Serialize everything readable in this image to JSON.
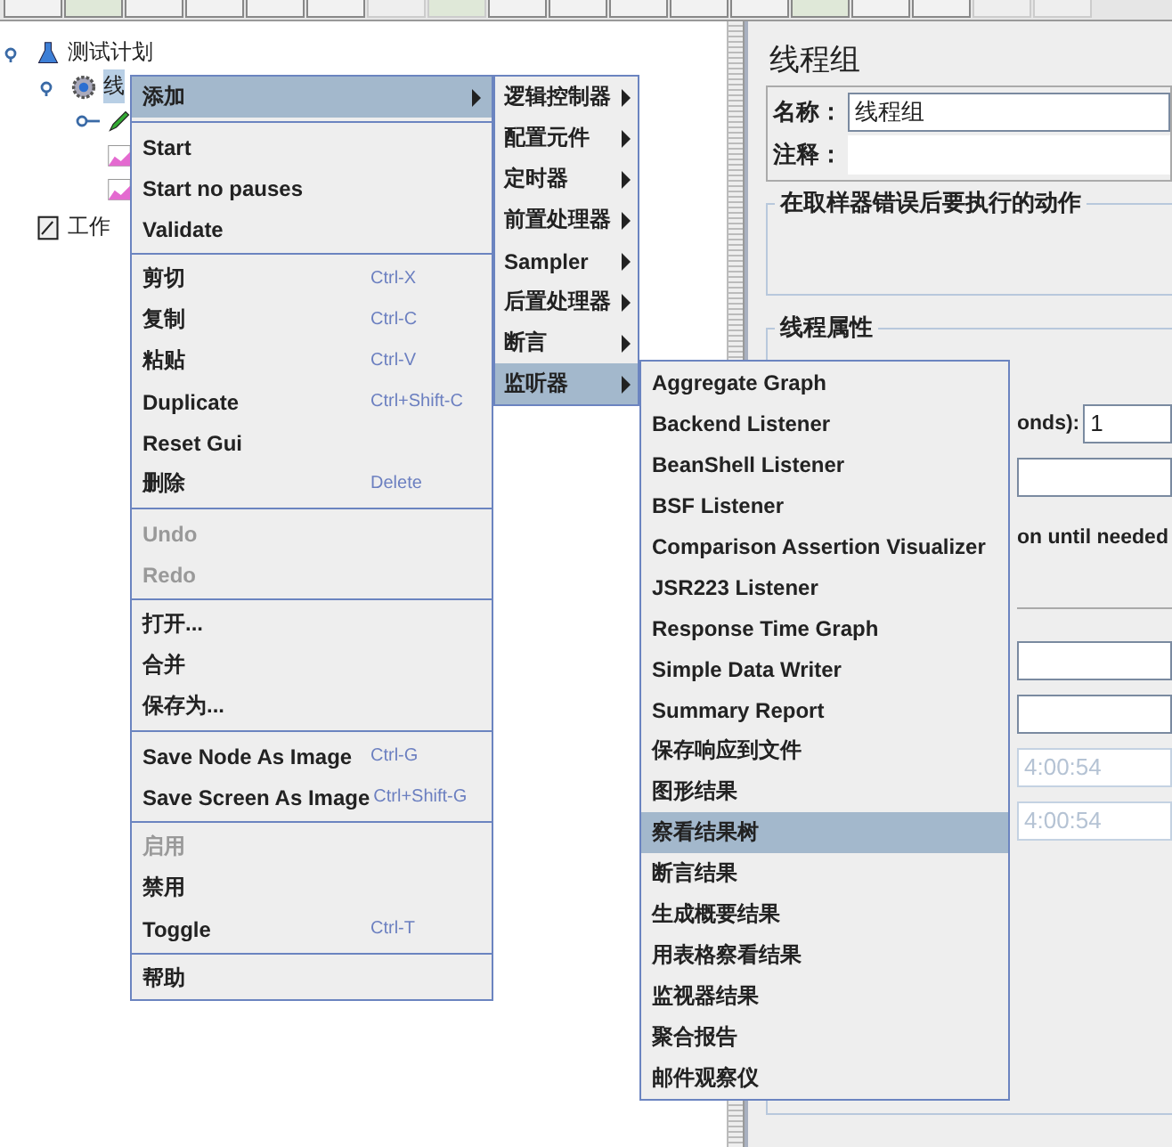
{
  "toolbar": {
    "buttons": [
      {
        "disabled": false
      },
      {
        "disabled": false
      },
      {
        "disabled": false
      },
      {
        "disabled": false
      },
      {
        "disabled": false
      },
      {
        "disabled": false
      },
      {
        "disabled": true
      },
      {
        "disabled": true
      },
      {
        "disabled": false
      },
      {
        "disabled": false
      },
      {
        "disabled": false
      },
      {
        "disabled": false
      },
      {
        "disabled": false
      },
      {
        "disabled": false
      },
      {
        "disabled": false
      },
      {
        "disabled": false
      },
      {
        "disabled": true
      },
      {
        "disabled": true
      }
    ]
  },
  "tree": [
    {
      "label": "测试计划",
      "kind": "plan",
      "selected": false,
      "expanded": true,
      "children": [
        {
          "label": "线",
          "kind": "thread-group",
          "selected": true,
          "expanded": true,
          "children": [
            {
              "kind": "sampler",
              "expanded": false
            },
            {
              "kind": "listener"
            },
            {
              "kind": "listener"
            }
          ]
        }
      ]
    },
    {
      "label": "工作",
      "kind": "workbench",
      "selected": false
    }
  ],
  "panel": {
    "title": "线程组",
    "name_label": "名称：",
    "name_value": "线程组",
    "comment_label": "注释：",
    "error_action_title": "在取样器错误后要执行的动作",
    "thread_props_title": "线程属性",
    "fragments": [
      {
        "kind": "label-input",
        "label": "onds):",
        "value": "1"
      },
      {
        "kind": "input"
      },
      {
        "kind": "text",
        "text": "on until needed"
      },
      {
        "kind": "rule"
      },
      {
        "kind": "input"
      },
      {
        "kind": "input"
      },
      {
        "kind": "disabled-input",
        "value": "4:00:54"
      },
      {
        "kind": "disabled-input",
        "value": "4:00:54"
      }
    ]
  },
  "context_menu": {
    "groups": [
      [
        {
          "label": "添加",
          "disabled": false,
          "selected": true,
          "submenu": true
        }
      ],
      [
        {
          "label": "Start",
          "disabled": false,
          "selected": false,
          "submenu": false
        },
        {
          "label": "Start no pauses",
          "disabled": false,
          "selected": false,
          "submenu": false
        },
        {
          "label": "Validate",
          "disabled": false,
          "selected": false,
          "submenu": false
        }
      ],
      [
        {
          "label": "剪切",
          "shortcut": "Ctrl-X",
          "disabled": false,
          "selected": false,
          "submenu": false
        },
        {
          "label": "复制",
          "shortcut": "Ctrl-C",
          "disabled": false,
          "selected": false,
          "submenu": false
        },
        {
          "label": "粘贴",
          "shortcut": "Ctrl-V",
          "disabled": false,
          "selected": false,
          "submenu": false
        },
        {
          "label": "Duplicate",
          "shortcut": "Ctrl+Shift-C",
          "disabled": false,
          "selected": false,
          "submenu": false
        },
        {
          "label": "Reset Gui",
          "disabled": false,
          "selected": false,
          "submenu": false
        },
        {
          "label": "删除",
          "shortcut": "Delete",
          "disabled": false,
          "selected": false,
          "submenu": false
        }
      ],
      [
        {
          "label": "Undo",
          "disabled": true,
          "selected": false,
          "submenu": false
        },
        {
          "label": "Redo",
          "disabled": true,
          "selected": false,
          "submenu": false
        }
      ],
      [
        {
          "label": "打开...",
          "disabled": false,
          "selected": false,
          "submenu": false
        },
        {
          "label": "合并",
          "disabled": false,
          "selected": false,
          "submenu": false
        },
        {
          "label": "保存为...",
          "disabled": false,
          "selected": false,
          "submenu": false
        }
      ],
      [
        {
          "label": "Save Node As Image",
          "shortcut": "Ctrl-G",
          "disabled": false,
          "selected": false,
          "submenu": false
        },
        {
          "label": "Save Screen As Image",
          "shortcut": "Ctrl+Shift-G",
          "disabled": false,
          "selected": false,
          "submenu": false
        }
      ],
      [
        {
          "label": "启用",
          "disabled": true,
          "selected": false,
          "submenu": false
        },
        {
          "label": "禁用",
          "disabled": false,
          "selected": false,
          "submenu": false
        },
        {
          "label": "Toggle",
          "shortcut": "Ctrl-T",
          "disabled": false,
          "selected": false,
          "submenu": false
        }
      ],
      [
        {
          "label": "帮助",
          "disabled": false,
          "selected": false,
          "submenu": false
        }
      ]
    ]
  },
  "add_submenu": {
    "items": [
      {
        "label": "逻辑控制器",
        "selected": false,
        "submenu": true
      },
      {
        "label": "配置元件",
        "selected": false,
        "submenu": true
      },
      {
        "label": "定时器",
        "selected": false,
        "submenu": true
      },
      {
        "label": "前置处理器",
        "selected": false,
        "submenu": true
      },
      {
        "label": "Sampler",
        "selected": false,
        "submenu": true
      },
      {
        "label": "后置处理器",
        "selected": false,
        "submenu": true
      },
      {
        "label": "断言",
        "selected": false,
        "submenu": true
      },
      {
        "label": "监听器",
        "selected": true,
        "submenu": true
      }
    ]
  },
  "listener_submenu": {
    "items": [
      {
        "label": "Aggregate Graph",
        "selected": false
      },
      {
        "label": "Backend Listener",
        "selected": false
      },
      {
        "label": "BeanShell Listener",
        "selected": false
      },
      {
        "label": "BSF Listener",
        "selected": false
      },
      {
        "label": "Comparison Assertion Visualizer",
        "selected": false
      },
      {
        "label": "JSR223 Listener",
        "selected": false
      },
      {
        "label": "Response Time Graph",
        "selected": false
      },
      {
        "label": "Simple Data Writer",
        "selected": false
      },
      {
        "label": "Summary Report",
        "selected": false
      },
      {
        "label": "保存响应到文件",
        "selected": false
      },
      {
        "label": "图形结果",
        "selected": false
      },
      {
        "label": "察看结果树",
        "selected": true
      },
      {
        "label": "断言结果",
        "selected": false
      },
      {
        "label": "生成概要结果",
        "selected": false
      },
      {
        "label": "用表格察看结果",
        "selected": false
      },
      {
        "label": "监视器结果",
        "selected": false
      },
      {
        "label": "聚合报告",
        "selected": false
      },
      {
        "label": "邮件观察仪",
        "selected": false
      }
    ]
  }
}
